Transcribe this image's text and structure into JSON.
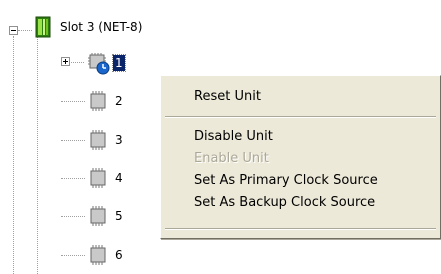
{
  "tree": {
    "root": {
      "label": "Slot 3 (NET-8)",
      "icon": "slot-card-icon",
      "expanded": true
    },
    "selected_unit": {
      "label": "1",
      "icon": "chip-clock-icon",
      "expanded": false
    },
    "units": [
      {
        "label": "2",
        "icon": "chip-icon"
      },
      {
        "label": "3",
        "icon": "chip-icon"
      },
      {
        "label": "4",
        "icon": "chip-icon"
      },
      {
        "label": "5",
        "icon": "chip-icon"
      },
      {
        "label": "6",
        "icon": "chip-icon"
      }
    ]
  },
  "context_menu": {
    "items": [
      {
        "label": "Reset Unit",
        "enabled": true
      },
      {
        "label": "Disable Unit",
        "enabled": true
      },
      {
        "label": "Enable Unit",
        "enabled": false
      },
      {
        "label": "Set As Primary Clock Source",
        "enabled": true
      },
      {
        "label": "Set As Backup Clock Source",
        "enabled": true
      }
    ]
  },
  "colors": {
    "selection": "#0a246a",
    "menu_bg": "#ece9d8",
    "disabled_text": "#aca899"
  }
}
